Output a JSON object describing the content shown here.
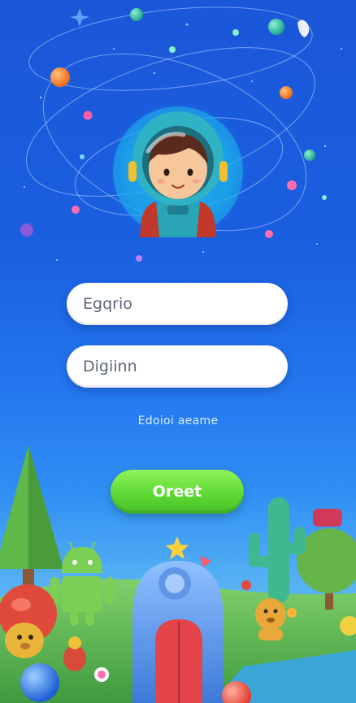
{
  "login": {
    "username_placeholder": "Egqrio",
    "password_placeholder": "Digiinn",
    "forgot_link": "Edoioi aeame",
    "submit_label": "Oreet"
  },
  "colors": {
    "background_top": "#1b57d8",
    "background_bottom": "#87d0ee",
    "button_green": "#5bd632",
    "input_text": "#5d6677"
  },
  "icons": [
    "astronaut-avatar-icon",
    "orbit-planets-decoration",
    "android-robot-icon",
    "castle-door-icon",
    "tree-icon",
    "cactus-icon",
    "dog-character-icon",
    "star-icon"
  ]
}
